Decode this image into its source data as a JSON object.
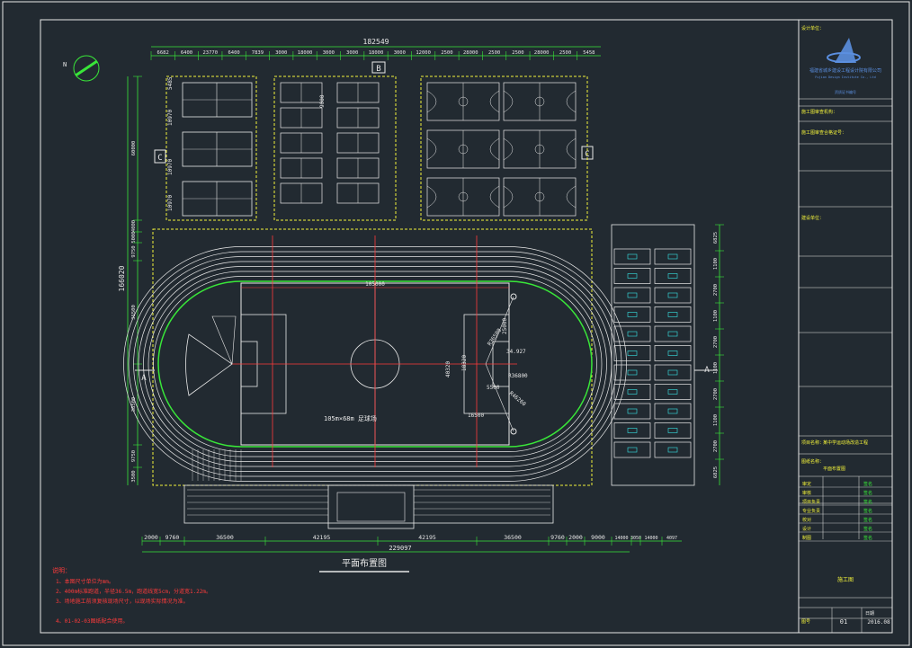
{
  "drawing": {
    "title": "平面布置图",
    "total_width_dim": "182549",
    "bottom_total_dim": "229097",
    "left_total_dim": "166020",
    "field_caption": "105m×68m 足球场",
    "center_dim": "105000",
    "section_a": "A",
    "section_b": "B",
    "section_c": "C"
  },
  "top_dims": [
    "6682",
    "6400",
    "23770",
    "6400",
    "7839",
    "3000",
    "18000",
    "3000",
    "3000",
    "18000",
    "3000",
    "12000",
    "2500",
    "28000",
    "2500",
    "2500",
    "28000",
    "2500",
    "5458"
  ],
  "bottom_dims": [
    "2000",
    "9760",
    "36500",
    "42195",
    "42195",
    "36500",
    "9760",
    "2000",
    "9000",
    "14000",
    "3050",
    "14000",
    "4097"
  ],
  "left_dims": [
    "60000",
    "4000",
    "5000",
    "9750",
    "36500",
    "38500",
    "9750",
    "3500"
  ],
  "right_dims": [
    "6825",
    "1100",
    "2700",
    "1100",
    "2700",
    "1100",
    "2700",
    "1100",
    "2700",
    "6825"
  ],
  "field_dims": [
    "25000",
    "40320",
    "18320",
    "16500",
    "5500",
    "R36500",
    "R36800",
    "34.927",
    "R46260"
  ],
  "court_dims": [
    "5485",
    "10970",
    "10970",
    "10970",
    "9000"
  ],
  "notes": {
    "heading": "说明：",
    "lines": [
      "1、本图尺寸单位为mm。",
      "2、400m标准跑道，半径36.5m，跑道线宽5cm，分道宽1.22m。",
      "3、场地施工前须复核现场尺寸，以现场实际情况为准。",
      "4、01-02-03图纸配合使用。"
    ]
  },
  "title_block": {
    "company": "福建省城乡建设工程设计院有限公司",
    "company_en": "Fujian Design Institute Co., Ltd",
    "cert_label": "资质证书编号",
    "fields": [
      "设计单位：",
      "施工图审查机构：",
      "施工图审查合格证号：",
      "建设单位：",
      "项目名称：",
      "图纸名称："
    ],
    "project": "某中学运动场改造工程",
    "drawing_name": "平面布置图",
    "roles": [
      "审定",
      "审核",
      "项目负责",
      "专业负责",
      "校对",
      "设计",
      "制图"
    ],
    "names": [
      "签名",
      "签名",
      "签名",
      "签名",
      "签名",
      "签名",
      "签名"
    ],
    "stage": "施工图",
    "no_label": "图号",
    "date_label": "日期",
    "drawing_no": "01",
    "date": "2016.08"
  },
  "colors": {
    "background": "#222a31",
    "white": "#e8e8e8",
    "yellow": "#f2f23a",
    "green": "#39e639",
    "red": "#ff3b3b",
    "cyan": "#38e8e8",
    "blue": "#5b8fe0"
  }
}
